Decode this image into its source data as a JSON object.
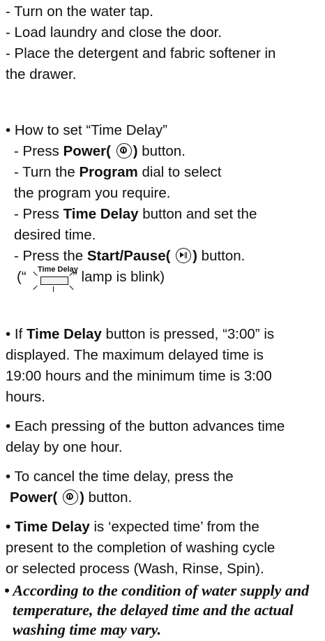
{
  "intro": {
    "line1": "- Turn on the water tap.",
    "line2": "- Load laundry and close the door.",
    "line3": "- Place the detergent and fabric softener in",
    "line4": " the drawer."
  },
  "howto": {
    "heading": "• How to set “Time Delay”",
    "step1_pre": "- Press ",
    "step1_bold": "Power(",
    "step1_bold2": ")",
    "step1_post": " button.",
    "step2_pre": "- Turn the ",
    "step2_bold": "Program",
    "step2_post": " dial to select",
    "step2_line2": " the program you require.",
    "step3_pre": "- Press ",
    "step3_bold": "Time Delay",
    "step3_post": " button and set the",
    "step3_line2": " desired time.",
    "step4_pre": "- Press the ",
    "step4_bold": "Start/Pause(",
    "step4_bold2": ")",
    "step4_post": " button.",
    "lamp_open": "(“",
    "lamp_label": "Time Delay",
    "lamp_close": "” lamp is blink)"
  },
  "notes": {
    "n1_pre": "• If ",
    "n1_bold": "Time Delay",
    "n1_post": " button is pressed, “3:00” is",
    "n1_l2": " displayed. The maximum delayed time is",
    "n1_l3": " 19:00 hours and the minimum time is 3:00",
    "n1_l4": " hours.",
    "n2_l1": "• Each pressing of the button advances time",
    "n2_l2": " delay by one hour.",
    "n3_l1": "• To cancel the time delay, press the",
    "n3_bold": "Power(",
    "n3_bold2": ")",
    "n3_post": " button.",
    "n4_bold": "• Time Delay",
    "n4_post": " is ‘expected time’ from the",
    "n4_l2": " present to the completion of washing cycle",
    "n4_l3": " or selected process (Wash, Rinse, Spin).",
    "caution_l1": "• According to the condition of water supply and",
    "caution_l2": "temperature, the delayed time and the actual",
    "caution_l3": "washing time may vary."
  },
  "icons": {
    "power": "power-icon",
    "start": "start-pause-icon",
    "lamp": "time-delay-lamp-icon"
  }
}
